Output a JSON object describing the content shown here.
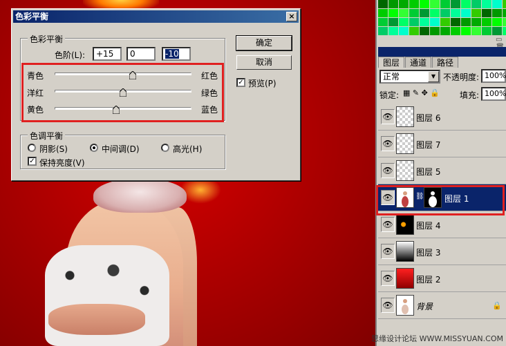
{
  "dialog": {
    "title": "色彩平衡",
    "color_balance_group": "色彩平衡",
    "levels_label": "色阶(L):",
    "levels": [
      "+15",
      "0",
      "-10"
    ],
    "sliders": [
      {
        "left": "青色",
        "right": "红色",
        "value": 15
      },
      {
        "left": "洋红",
        "right": "绿色",
        "value": 0
      },
      {
        "left": "黄色",
        "right": "蓝色",
        "value": -10
      }
    ],
    "tone_group": "色调平衡",
    "tones": [
      "阴影(S)",
      "中间调(D)",
      "高光(H)"
    ],
    "selected_tone": "中间调(D)",
    "preserve_luminosity": "保持亮度(V)",
    "ok": "确定",
    "cancel": "取消",
    "preview": "预览(P)",
    "close_glyph": "×"
  },
  "layers_panel": {
    "tabs": [
      "图层",
      "通道",
      "路径"
    ],
    "blend_mode": "正常",
    "opacity_label": "不透明度:",
    "opacity": "100%",
    "lock_label": "锁定:",
    "fill_label": "填充:",
    "fill": "100%",
    "layers": [
      {
        "name": "图层 6",
        "thumb": "transparent"
      },
      {
        "name": "图层 7",
        "thumb": "transparent"
      },
      {
        "name": "图层 5",
        "thumb": "transparent"
      },
      {
        "name": "图层 1",
        "thumb": "photo-with-mask",
        "selected": true
      },
      {
        "name": "图层 4",
        "thumb": "dark-sparkles"
      },
      {
        "name": "图层 3",
        "thumb": "gradient-white-black"
      },
      {
        "name": "图层 2",
        "thumb": "red-gradient"
      },
      {
        "name": "背景",
        "thumb": "photo",
        "locked": true
      }
    ]
  },
  "watermark": "思缘设计论坛 WWW.MISSYUAN.COM",
  "colors": {
    "title_blue": "#0a246a",
    "highlight_red": "#e02020",
    "window_gray": "#d4d0c8"
  }
}
